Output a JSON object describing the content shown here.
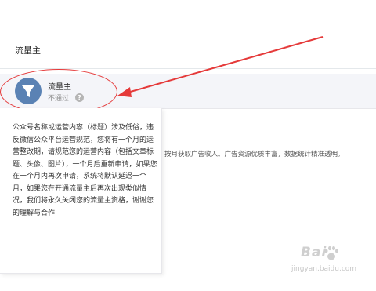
{
  "header": {
    "title": "流量主"
  },
  "service": {
    "name": "流量主",
    "status": "不通过",
    "help_glyph": "?",
    "icon": "funnel-icon",
    "icon_color": "#5a82b4"
  },
  "tooltip": {
    "text": "公众号名称或运营内容（标题）涉及低俗，违反微信公众平台运营规范，您将有一个月的运营整改期，请规范您的运营内容（包括文章标题、头像、图片），一个月后重新申请，如果您在一个月内再次申请，系统将默认延迟一个月，如果您在开通流量主后再次出现类似情况，我们将永久关闭您的流量主资格，谢谢您的理解与合作"
  },
  "main": {
    "ad_intro": "按月获取广告收入。广告资源优质丰富，数据统计精准透明。"
  },
  "annotation": {
    "color": "#e53a3a"
  },
  "watermark": {
    "brand": "Bai",
    "url": "jingyan.baidu.com",
    "icon": "paw-icon"
  }
}
